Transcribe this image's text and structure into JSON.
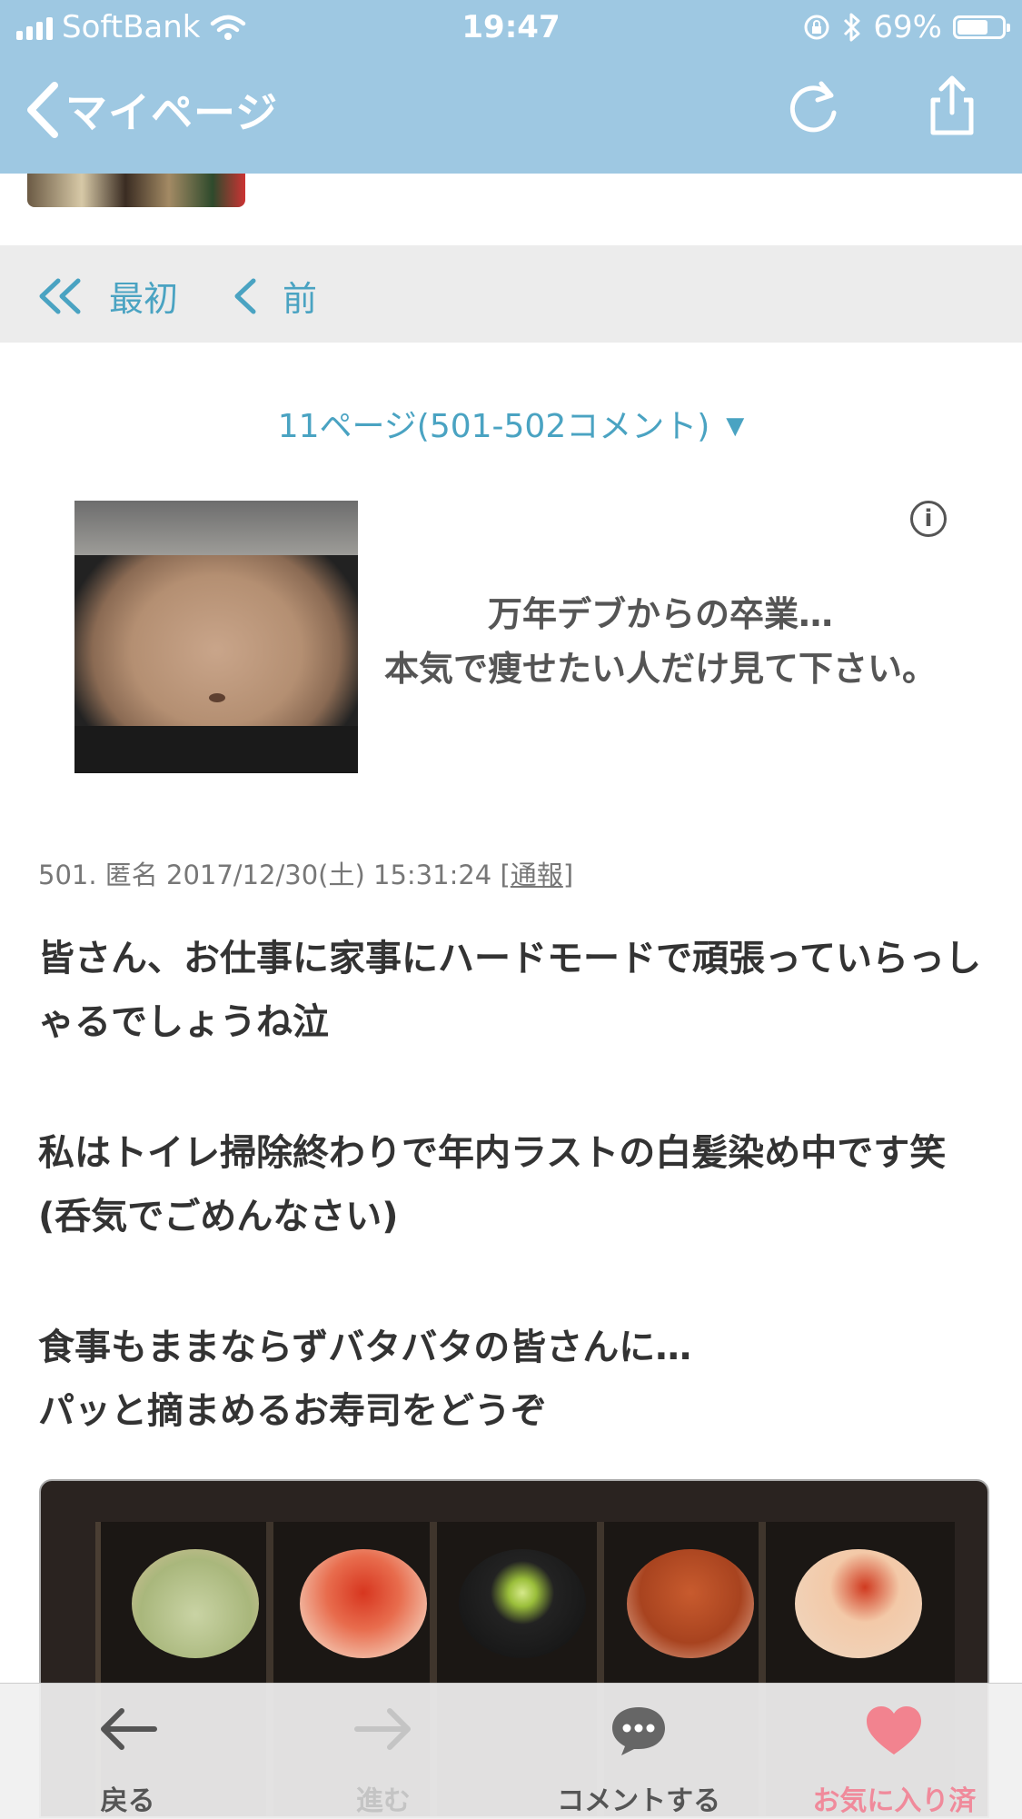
{
  "status_bar": {
    "carrier": "SoftBank",
    "time": "19:47",
    "battery_percent": "69%",
    "battery_level": 0.69
  },
  "nav": {
    "back_label": "マイページ",
    "background_color": "#9ec8e2"
  },
  "pager": {
    "first_label": "最初",
    "prev_label": "前"
  },
  "page_select": {
    "label": "11ページ(501-502コメント)",
    "arrow": "▼"
  },
  "ad": {
    "line1": "万年デブからの卒業…",
    "line2": "本気で痩せたい人だけ見て下さい。",
    "info_glyph": "i"
  },
  "comment": {
    "meta": "501. 匿名 2017/12/30(土) 15:31:24",
    "report_open": "[",
    "report_label": "通報",
    "report_close": "]",
    "paragraphs": [
      "皆さん、お仕事に家事にハードモードで頑張っていらっしゃるでしょうね泣",
      "私はトイレ掃除終わりで年内ラストの白髪染め中です笑(呑気でごめんなさい)",
      "食事もままならずバタバタの皆さんに…\nパッと摘まめるお寿司をどうぞ"
    ]
  },
  "toolbar": {
    "back_label": "戻る",
    "forward_label": "進む",
    "comment_label": "コメントする",
    "favorite_label": "お気に入り済"
  },
  "colors": {
    "accent": "#4aa3c2",
    "favorite": "#f08a9b"
  }
}
